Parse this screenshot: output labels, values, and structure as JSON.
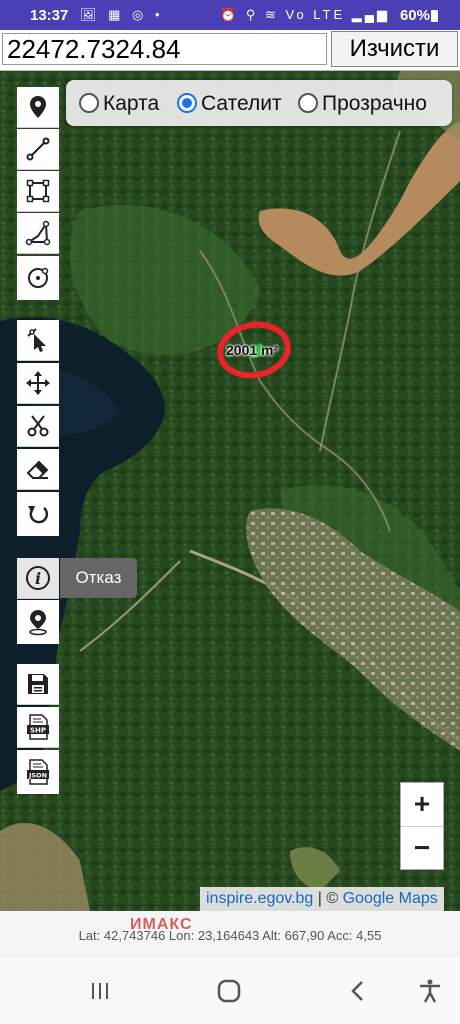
{
  "status": {
    "time": "13:37",
    "left_icons": "🖼 ▦ ◎ •",
    "right_icons": "⏰ ⚲ ≋ Vo LTE ▂▄▆",
    "battery": "60%"
  },
  "toolbar_top": {
    "coords_value": "22472.7324.84",
    "clear_label": "Изчисти"
  },
  "map_type": {
    "options": [
      "Карта",
      "Сателит",
      "Прозрачно"
    ],
    "selected": "Сателит"
  },
  "tools": {
    "marker": "map-marker-icon",
    "line": "line-draw-icon",
    "rectangle": "rectangle-draw-icon",
    "polygon": "polygon-draw-icon",
    "circle": "circle-draw-icon",
    "select": "select-cursor-icon",
    "move": "move-arrows-icon",
    "cut": "scissors-icon",
    "erase": "eraser-icon",
    "undo": "undo-icon",
    "info": "info-icon",
    "locate": "location-pin-icon",
    "save": "save-floppy-icon",
    "shp": "shp-file-icon",
    "json": "json-file-icon"
  },
  "tooltip": "Отказ",
  "shape": {
    "area_label": "2001 m²",
    "outline_color": "#e8232a"
  },
  "zoom": {
    "in": "+",
    "out": "−"
  },
  "attribution": {
    "site": "inspire.egov.bg",
    "separator": " | © ",
    "provider": "Google Maps"
  },
  "gps_readout": "Lat: 42,743746 Lon: 23,164643 Alt: 667,90 Acc: 4,55",
  "watermark": "ИМАКС",
  "colors": {
    "statusbar": "#4a3fb5",
    "radio_selected": "#1a73e8",
    "link": "#1a66c8"
  }
}
